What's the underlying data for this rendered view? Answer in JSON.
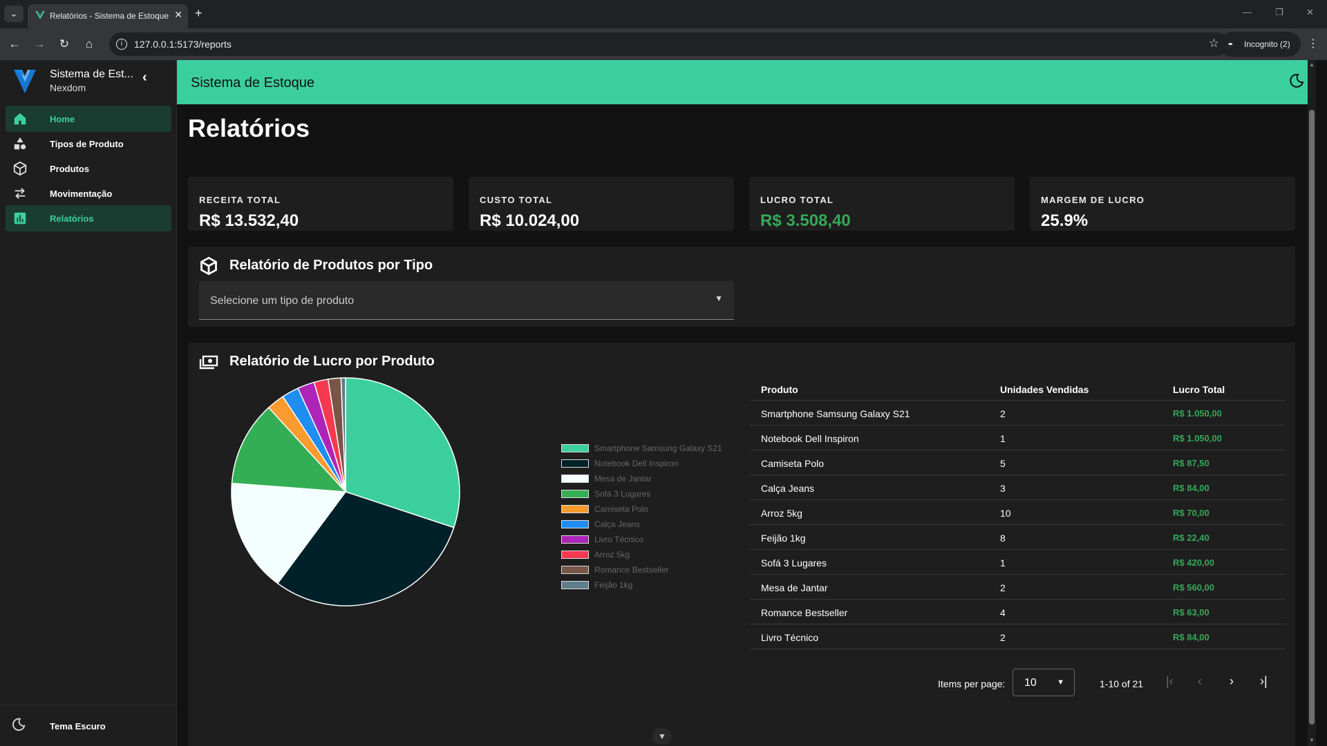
{
  "browser": {
    "tab_title": "Relatórios - Sistema de Estoque",
    "url": "127.0.0.1:5173/reports",
    "incognito_label": "Incognito (2)",
    "tab_menu_glyph": "⌄",
    "tab_close_glyph": "✕",
    "new_tab_glyph": "+",
    "back_glyph": "←",
    "forward_glyph": "→",
    "reload_glyph": "↻",
    "home_glyph": "⌂",
    "info_glyph": "i",
    "star_glyph": "☆",
    "incognito_glyph": "◓",
    "kebab_glyph": "⋮",
    "minimize_glyph": "—",
    "restore_glyph": "❐",
    "close_glyph": "✕"
  },
  "sidebar": {
    "brand_name": "Sistema de Est...",
    "brand_sub": "Nexdom",
    "collapse_glyph": "‹",
    "items": [
      {
        "label": "Home",
        "icon": "home-icon",
        "active": true
      },
      {
        "label": "Tipos de Produto",
        "icon": "shapes-icon",
        "active": false
      },
      {
        "label": "Produtos",
        "icon": "cube-icon",
        "active": false
      },
      {
        "label": "Movimentação",
        "icon": "swap-icon",
        "active": false
      },
      {
        "label": "Relatórios",
        "icon": "chart-bar-icon",
        "active": true
      }
    ],
    "footer_label": "Tema Escuro"
  },
  "appbar": {
    "title": "Sistema de Estoque"
  },
  "page": {
    "title": "Relatórios"
  },
  "stats": [
    {
      "label": "RECEITA TOTAL",
      "value": "R$ 13.532,40"
    },
    {
      "label": "CUSTO TOTAL",
      "value": "R$ 10.024,00"
    },
    {
      "label": "LUCRO TOTAL",
      "value": "R$ 3.508,40"
    },
    {
      "label": "MARGEM DE LUCRO",
      "value": "25.9%"
    }
  ],
  "by_type": {
    "title": "Relatório de Produtos por Tipo",
    "select_placeholder": "Selecione um tipo de produto",
    "caret_glyph": "▼"
  },
  "profit": {
    "title": "Relatório de Lucro por Produto",
    "columns": [
      "Produto",
      "Unidades Vendidas",
      "Lucro Total"
    ],
    "rows": [
      [
        "Smartphone Samsung Galaxy S21",
        "2",
        "R$ 1.050,00"
      ],
      [
        "Notebook Dell Inspiron",
        "1",
        "R$ 1.050,00"
      ],
      [
        "Camiseta Polo",
        "5",
        "R$ 87,50"
      ],
      [
        "Calça Jeans",
        "3",
        "R$ 84,00"
      ],
      [
        "Arroz 5kg",
        "10",
        "R$ 70,00"
      ],
      [
        "Feijão 1kg",
        "8",
        "R$ 22,40"
      ],
      [
        "Sofá 3 Lugares",
        "1",
        "R$ 420,00"
      ],
      [
        "Mesa de Jantar",
        "2",
        "R$ 560,00"
      ],
      [
        "Romance Bestseller",
        "4",
        "R$ 63,00"
      ],
      [
        "Livro Técnico",
        "2",
        "R$ 84,00"
      ]
    ],
    "pager": {
      "items_per_page_label": "Items per page:",
      "items_per_page_value": "10",
      "caret_glyph": "▼",
      "range": "1-10 of 21",
      "first_glyph": "|‹",
      "prev_glyph": "‹",
      "next_glyph": "›",
      "last_glyph": "›|"
    }
  },
  "scroll_hint_glyph": "▼",
  "colors": {
    "accent": "#3ccf9e",
    "profit_green": "#36a85a"
  },
  "chart_data": {
    "type": "pie",
    "categories": [
      "Smartphone Samsung Galaxy S21",
      "Notebook Dell Inspiron",
      "Mesa de Jantar",
      "Sofá 3 Lugares",
      "Camiseta Polo",
      "Calça Jeans",
      "Livro Técnico",
      "Arroz 5kg",
      "Romance Bestseller",
      "Feijão 1kg"
    ],
    "values": [
      1050,
      1050,
      560,
      420,
      87.5,
      84,
      84,
      70,
      63,
      22.4
    ],
    "colors": [
      "#3ccf9e",
      "#002129",
      "#f2fffe",
      "#34ae55",
      "#fb9a2e",
      "#1f8ef0",
      "#ad24b8",
      "#f5394f",
      "#795548",
      "#607d8b"
    ],
    "legend_position": "right"
  }
}
